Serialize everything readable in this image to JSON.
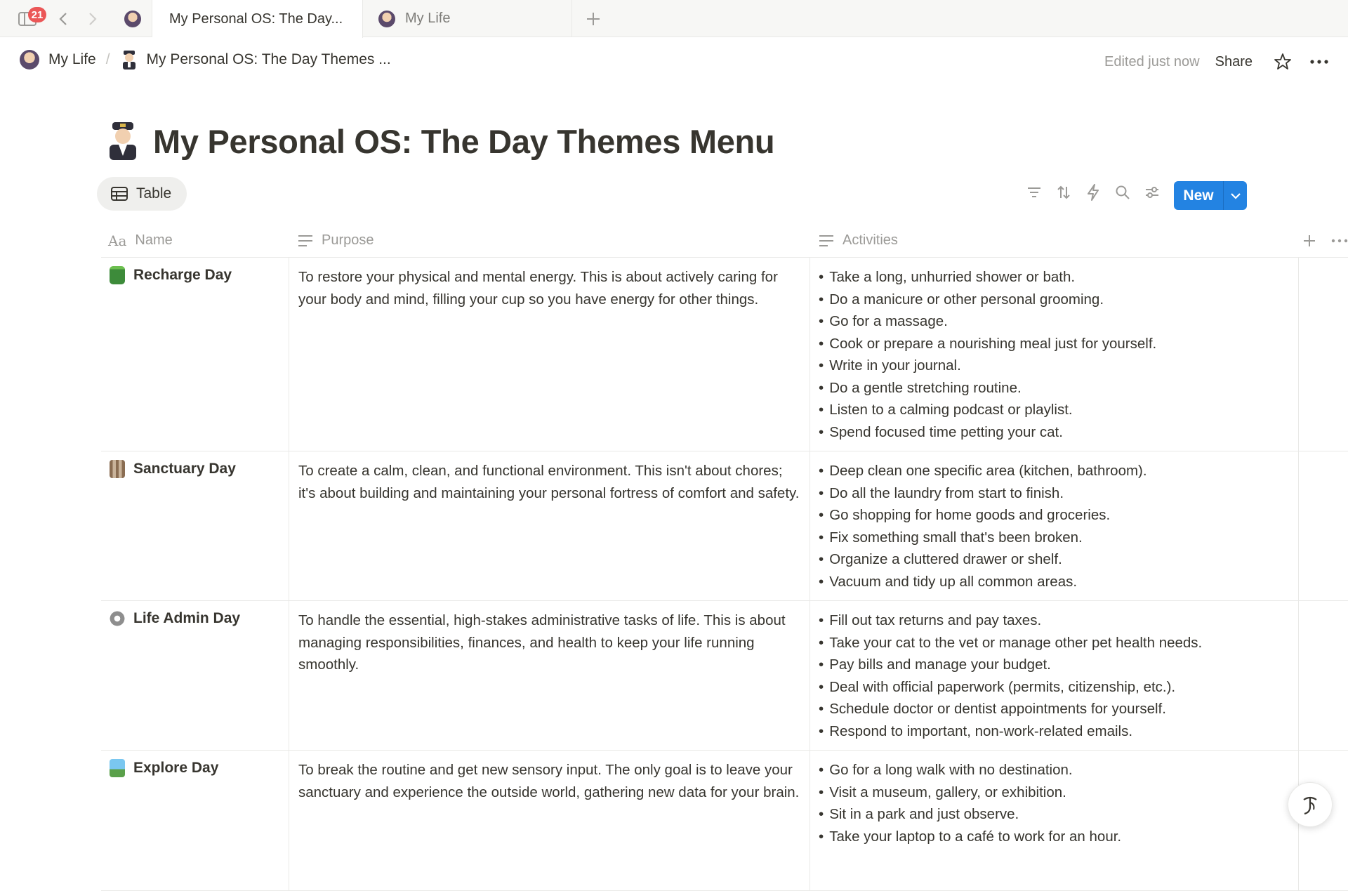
{
  "tabbar": {
    "notification_count": "21",
    "tabs": [
      {
        "label": "My Personal OS: The Day...",
        "active": true
      },
      {
        "label": "My Life",
        "active": false
      }
    ]
  },
  "breadcrumb": {
    "items": [
      "My Life",
      "My Personal OS: The Day Themes ..."
    ],
    "separator": "/"
  },
  "topbar": {
    "edited": "Edited just now",
    "share": "Share"
  },
  "page": {
    "title": "My Personal OS: The Day Themes Menu"
  },
  "view": {
    "tab_label": "Table",
    "new_label": "New"
  },
  "table": {
    "columns": [
      "Name",
      "Purpose",
      "Activities"
    ],
    "rows": [
      {
        "name": "Recharge Day",
        "icon": "battery-icon",
        "purpose": "To restore your physical and mental energy. This is about actively caring for your body and mind, filling your cup so you have energy for other things.",
        "activities": [
          "Take a long, unhurried shower or bath.",
          "Do a manicure or other personal grooming.",
          "Go for a massage.",
          "Cook or prepare a nourishing meal just for yourself.",
          "Write in your journal.",
          "Do a gentle stretching routine.",
          "Listen to a calming podcast or playlist.",
          "Spend focused time petting your cat."
        ]
      },
      {
        "name": "Sanctuary Day",
        "icon": "castle-icon",
        "purpose": "To create a calm, clean, and functional environment. This isn't about chores; it's about building and maintaining your personal fortress of comfort and safety.",
        "activities": [
          "Deep clean one specific area (kitchen, bathroom).",
          "Do all the laundry from start to finish.",
          "Go shopping for home goods and groceries.",
          "Fix something small that's been broken.",
          "Organize a cluttered drawer or shelf.",
          "Vacuum and tidy up all common areas."
        ]
      },
      {
        "name": "Life Admin Day",
        "icon": "gear-icon",
        "purpose": "To handle the essential, high-stakes administrative tasks of life. This is about managing responsibilities, finances, and health to keep your life running smoothly.",
        "activities": [
          "Fill out tax returns and pay taxes.",
          "Take your cat to the vet or manage other pet health needs.",
          "Pay bills and manage your budget.",
          "Deal with official paperwork (permits, citizenship, etc.).",
          "Schedule doctor or dentist appointments for yourself.",
          "Respond to important, non-work-related emails."
        ]
      },
      {
        "name": "Explore Day",
        "icon": "map-icon",
        "purpose": "To break the routine and get new sensory input. The only goal is to leave your sanctuary and experience the outside world, gathering new data for your brain.",
        "activities": [
          "Go for a long walk with no destination.",
          "Visit a museum, gallery, or exhibition.",
          "Sit in a park and just observe.",
          "Take your laptop to a café to work for an hour."
        ]
      }
    ]
  },
  "colors": {
    "accent": "#2383e2",
    "badge": "#eb5757",
    "text": "#37352f",
    "muted": "#9b9a97",
    "border": "#e9e9e7"
  }
}
